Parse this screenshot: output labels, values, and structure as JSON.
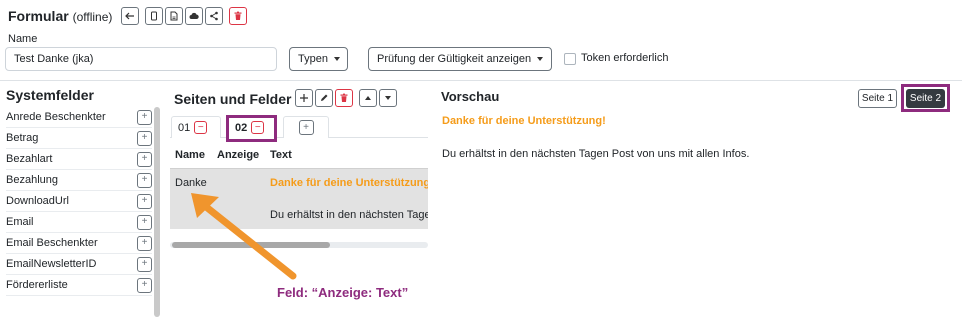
{
  "header": {
    "title": "Formular",
    "status": "(offline)",
    "toolbar_icons": [
      "arrow-left-icon",
      "copy-icon",
      "file-icon",
      "cloud-upload-icon",
      "share-icon",
      "trash-icon"
    ]
  },
  "form": {
    "name_label": "Name",
    "name_value": "Test Danke (jka)",
    "type_select": "Typen",
    "validity_select": "Prüfung der Gültigkeit anzeigen",
    "token_label": "Token erforderlich",
    "token_checked": false
  },
  "systemfelder": {
    "title": "Systemfelder",
    "items": [
      {
        "label": "Anrede Beschenkter"
      },
      {
        "label": "Betrag"
      },
      {
        "label": "Bezahlart"
      },
      {
        "label": "Bezahlung"
      },
      {
        "label": "DownloadUrl"
      },
      {
        "label": "Email"
      },
      {
        "label": "Email Beschenkter"
      },
      {
        "label": "EmailNewsletterID"
      },
      {
        "label": "Fördererliste"
      }
    ],
    "add_symbol": "+"
  },
  "seiten": {
    "title": "Seiten und Felder",
    "tools": [
      "plus-icon",
      "pencil-icon",
      "trash-icon",
      "caret-up-icon",
      "caret-down-icon"
    ],
    "tabs": [
      {
        "label": "01",
        "remove": "−"
      },
      {
        "label": "02",
        "remove": "−",
        "active": true
      }
    ],
    "add_tab": "+",
    "columns": [
      "Name",
      "Anzeige",
      "Text"
    ],
    "rows": [
      {
        "name": "Danke",
        "anzeige": "",
        "text1": "Danke für deine Unterstützung!",
        "text2": "Du erhältst in den nächsten Tagen Post von uns mit allen Infos."
      }
    ]
  },
  "annotation": {
    "label": "Feld: “Anzeige: Text”",
    "color": "#8e2b7e",
    "arrow_color": "#f0952d"
  },
  "vorschau": {
    "title": "Vorschau",
    "page_buttons": [
      "Seite 1",
      "Seite 2"
    ],
    "active_page": "Seite 2",
    "headline": "Danke für deine Unterstützung!",
    "text": "Du erhältst in den nächsten Tagen Post von uns mit allen Infos.",
    "accent_color": "#f59c1a"
  }
}
